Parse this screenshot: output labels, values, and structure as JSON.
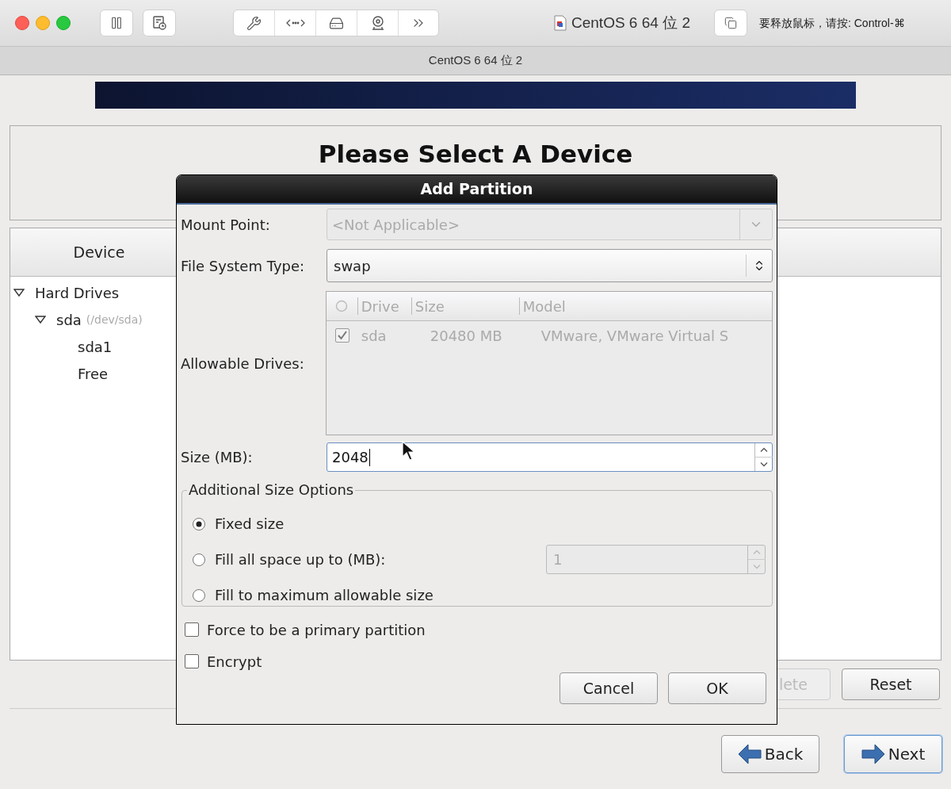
{
  "toolbar": {
    "vm_title": "CentOS 6 64 位 2",
    "hint": "要释放鼠标，请按: Control-⌘"
  },
  "window": {
    "title": "CentOS 6 64 位 2"
  },
  "installer": {
    "header": "Please Select A Device",
    "device_tree": {
      "column": "Device",
      "items": [
        {
          "label": "Hard Drives",
          "expanded": true,
          "children": [
            {
              "label": "sda",
              "detail": "(/dev/sda)",
              "expanded": true,
              "children": [
                {
                  "label": "sda1"
                },
                {
                  "label": "Free"
                }
              ]
            }
          ]
        }
      ]
    },
    "buttons": [
      {
        "label": "lete",
        "disabled": true
      },
      {
        "label": "Reset",
        "disabled": false
      }
    ],
    "nav": [
      {
        "label": "Back",
        "kind": "back",
        "focused": false
      },
      {
        "label": "Next",
        "kind": "next",
        "focused": true
      }
    ]
  },
  "dialog": {
    "title": "Add Partition",
    "mount_point": {
      "label": "Mount Point:",
      "value": "<Not Applicable>",
      "disabled": true
    },
    "fs_type": {
      "label": "File System Type:",
      "value": "swap",
      "disabled": false
    },
    "drives": {
      "label": "Allowable Drives:",
      "disabled": true,
      "columns": [
        "Drive",
        "Size",
        "Model"
      ],
      "rows": [
        {
          "checked": true,
          "cells": [
            "sda",
            "20480 MB",
            "VMware, VMware Virtual S"
          ]
        }
      ]
    },
    "size": {
      "label": "Size (MB):",
      "value": "2048"
    },
    "size_options": {
      "legend": "Additional Size Options",
      "options": [
        {
          "label": "Fixed size",
          "selected": true
        },
        {
          "label": "Fill all space up to (MB):",
          "selected": false,
          "field": {
            "value": "1",
            "disabled": true
          }
        },
        {
          "label": "Fill to maximum allowable size",
          "selected": false
        }
      ]
    },
    "checkboxes": [
      {
        "label": "Force to be a primary partition",
        "checked": false
      },
      {
        "label": "Encrypt",
        "checked": false
      }
    ],
    "buttons": [
      "Cancel",
      "OK"
    ]
  }
}
